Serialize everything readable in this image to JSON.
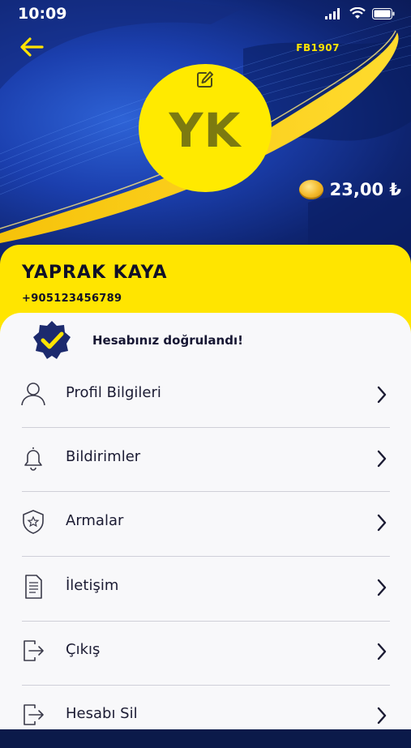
{
  "status_bar": {
    "time": "10:09"
  },
  "header": {
    "code": "FB1907"
  },
  "profile": {
    "initials": "YK",
    "name": "YAPRAK KAYA",
    "phone": "+905123456789"
  },
  "balance": {
    "amount": "23,00 ₺"
  },
  "verification": {
    "text": "Hesabınız doğrulandı!"
  },
  "menu": {
    "items": [
      {
        "label": "Profil Bilgileri",
        "icon": "user-icon"
      },
      {
        "label": "Bildirimler",
        "icon": "bell-icon"
      },
      {
        "label": "Armalar",
        "icon": "shield-star-icon"
      },
      {
        "label": "İletişim",
        "icon": "document-icon"
      },
      {
        "label": "Çıkış",
        "icon": "logout-icon"
      },
      {
        "label": "Hesabı Sil",
        "icon": "logout-icon"
      }
    ]
  },
  "colors": {
    "accent_yellow": "#ffe500",
    "navy": "#1b3fae",
    "text_dark": "#1b1b33",
    "background": "#f8f8fa"
  }
}
